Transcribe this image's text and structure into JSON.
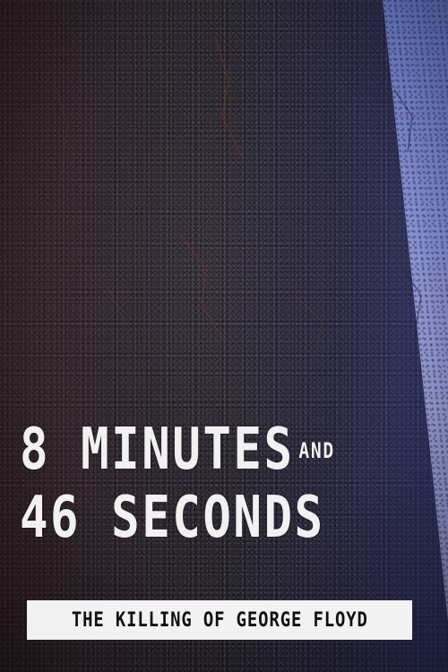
{
  "poster": {
    "title_line1": "8 MINUTES",
    "title_and": "AND",
    "title_line2": "46 SECONDS",
    "subtitle": "THE KILLING OF GEORGE FLOYD"
  },
  "colors": {
    "asphalt": "#2a2830",
    "lane_stripe": "#c9d2ff",
    "title_text": "#f1f1f1",
    "subtitle_box": "#f2f2f2",
    "subtitle_text": "#111111"
  }
}
